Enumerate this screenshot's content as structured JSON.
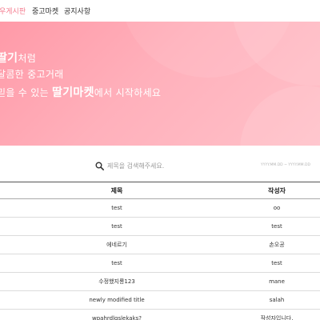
{
  "nav": {
    "items": [
      {
        "label": "우게시판",
        "active": true
      },
      {
        "label": "중고마켓",
        "active": false
      },
      {
        "label": "공지사항",
        "active": false
      }
    ]
  },
  "hero": {
    "line1_bold": "딸기",
    "line1_rest": "처럼",
    "line2": "달콤한 중고거래",
    "line3_pre": "믿을 수 있는 ",
    "line3_bold": "딸기마켓",
    "line3_post": "에서 시작하세요"
  },
  "search": {
    "placeholder": "제목을 검색해주세요.",
    "value": "",
    "icon": "search-icon",
    "date_range": "YYYY.MM.DD ~ YYYY.MM.DD"
  },
  "table": {
    "headers": {
      "title": "제목",
      "author": "작성자"
    },
    "rows": [
      {
        "title": "test",
        "author": "oo"
      },
      {
        "title": "test",
        "author": "test"
      },
      {
        "title": "에네르기",
        "author": "손오공"
      },
      {
        "title": "test",
        "author": "test"
      },
      {
        "title": "수정했지롱123",
        "author": "mane"
      },
      {
        "title": "newly modified title",
        "author": "salah"
      },
      {
        "title": "wpahrdlqslekaks?",
        "author": "작성자입니다."
      }
    ]
  },
  "colors": {
    "accent": "#f47c8f",
    "hero_start": "#ff9aa8",
    "hero_end": "#ffc1c9"
  }
}
